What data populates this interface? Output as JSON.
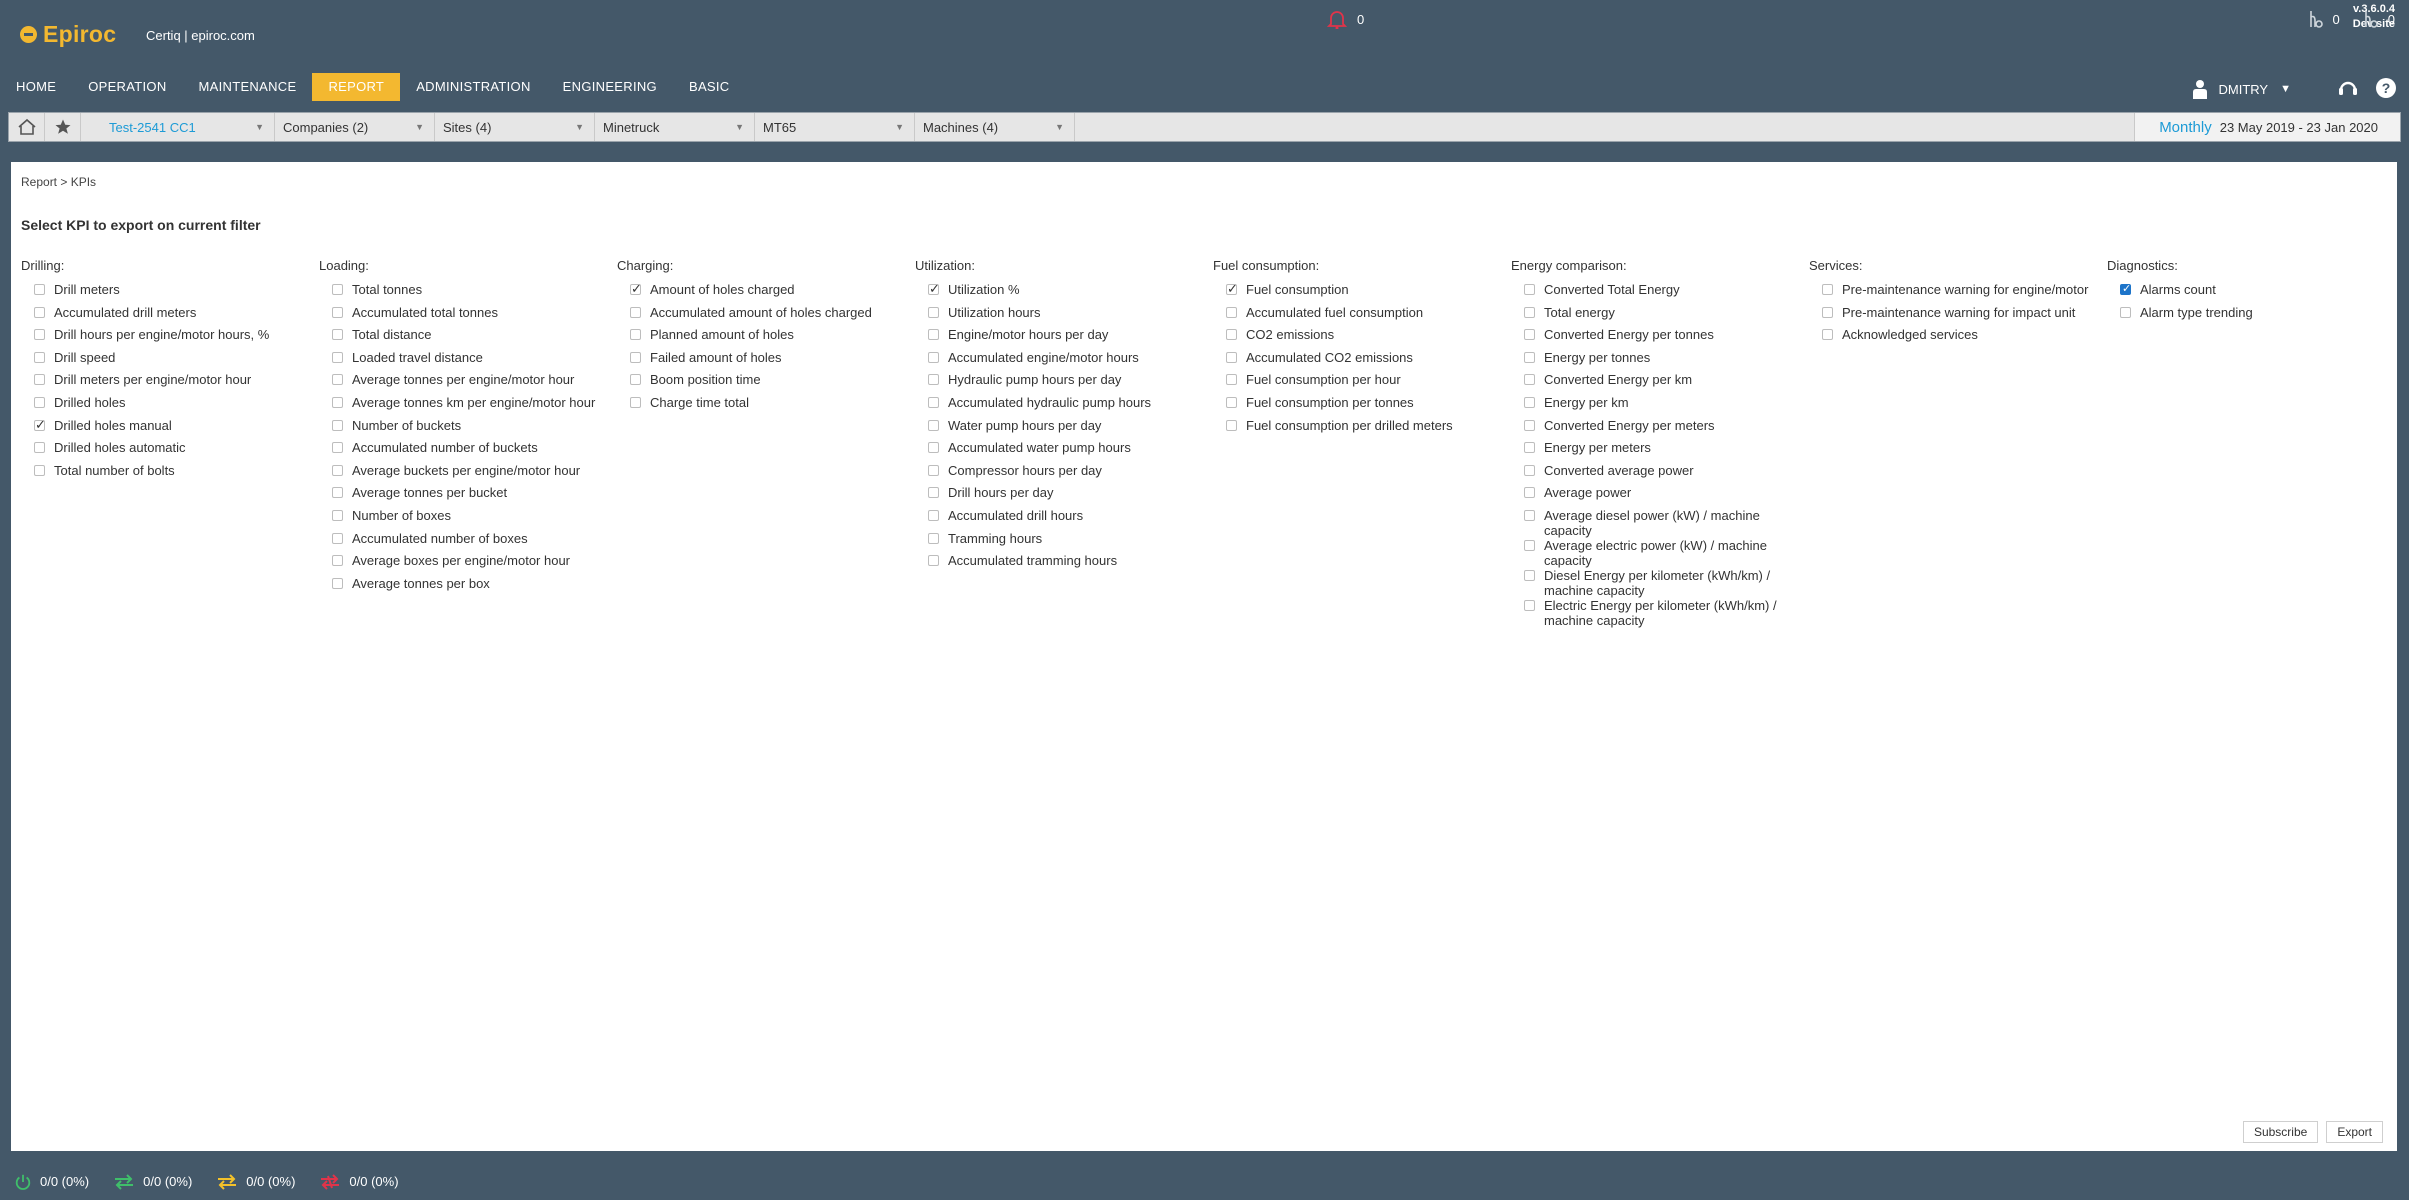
{
  "header": {
    "logo_text": "Epiroc",
    "site_name": "Certiq | epiroc.com",
    "version_line1": "v.3.6.0.4",
    "version_line2": "Dev site"
  },
  "nav": {
    "items": [
      "HOME",
      "OPERATION",
      "MAINTENANCE",
      "REPORT",
      "ADMINISTRATION",
      "ENGINEERING",
      "BASIC"
    ],
    "active": "REPORT",
    "user_name": "DMITRY",
    "user_caret": "▼"
  },
  "filters": {
    "selects": [
      "Test-2541 CC1",
      "Companies (2)",
      "Sites (4)",
      "Minetruck",
      "MT65",
      "Machines (4)"
    ],
    "period_mode": "Monthly",
    "date_range": "23 May 2019 - 23 Jan 2020"
  },
  "page": {
    "breadcrumb": "Report > KPIs",
    "heading": "Select KPI to export on current filter"
  },
  "categories": [
    {
      "title": "Drilling:",
      "items": [
        {
          "label": "Drill meters",
          "checked": false
        },
        {
          "label": "Accumulated drill meters",
          "checked": false
        },
        {
          "label": "Drill hours per engine/motor hours, %",
          "checked": false
        },
        {
          "label": "Drill speed",
          "checked": false
        },
        {
          "label": "Drill meters per engine/motor hour",
          "checked": false
        },
        {
          "label": "Drilled holes",
          "checked": false
        },
        {
          "label": "Drilled holes manual",
          "checked": true
        },
        {
          "label": "Drilled holes automatic",
          "checked": false
        },
        {
          "label": "Total number of bolts",
          "checked": false
        }
      ]
    },
    {
      "title": "Loading:",
      "items": [
        {
          "label": "Total tonnes",
          "checked": false
        },
        {
          "label": "Accumulated total tonnes",
          "checked": false
        },
        {
          "label": "Total distance",
          "checked": false
        },
        {
          "label": "Loaded travel distance",
          "checked": false
        },
        {
          "label": "Average tonnes per engine/motor hour",
          "checked": false
        },
        {
          "label": "Average tonnes km per engine/motor hour",
          "checked": false
        },
        {
          "label": "Number of buckets",
          "checked": false
        },
        {
          "label": "Accumulated number of buckets",
          "checked": false
        },
        {
          "label": "Average buckets per engine/motor hour",
          "checked": false
        },
        {
          "label": "Average tonnes per bucket",
          "checked": false
        },
        {
          "label": "Number of boxes",
          "checked": false
        },
        {
          "label": "Accumulated number of boxes",
          "checked": false
        },
        {
          "label": "Average boxes per engine/motor hour",
          "checked": false
        },
        {
          "label": "Average tonnes per box",
          "checked": false
        }
      ]
    },
    {
      "title": "Charging:",
      "items": [
        {
          "label": "Amount of holes charged",
          "checked": true
        },
        {
          "label": "Accumulated amount of holes charged",
          "checked": false
        },
        {
          "label": "Planned amount of holes",
          "checked": false
        },
        {
          "label": "Failed amount of holes",
          "checked": false
        },
        {
          "label": "Boom position time",
          "checked": false
        },
        {
          "label": "Charge time total",
          "checked": false
        }
      ]
    },
    {
      "title": "Utilization:",
      "items": [
        {
          "label": "Utilization %",
          "checked": true
        },
        {
          "label": "Utilization hours",
          "checked": false
        },
        {
          "label": "Engine/motor hours per day",
          "checked": false
        },
        {
          "label": "Accumulated engine/motor hours",
          "checked": false
        },
        {
          "label": "Hydraulic pump hours per day",
          "checked": false
        },
        {
          "label": "Accumulated hydraulic pump hours",
          "checked": false
        },
        {
          "label": "Water pump hours per day",
          "checked": false
        },
        {
          "label": "Accumulated water pump hours",
          "checked": false
        },
        {
          "label": "Compressor hours per day",
          "checked": false
        },
        {
          "label": "Drill hours per day",
          "checked": false
        },
        {
          "label": "Accumulated drill hours",
          "checked": false
        },
        {
          "label": "Tramming hours",
          "checked": false
        },
        {
          "label": "Accumulated tramming hours",
          "checked": false
        }
      ]
    },
    {
      "title": "Fuel consumption:",
      "items": [
        {
          "label": "Fuel consumption",
          "checked": true
        },
        {
          "label": "Accumulated fuel consumption",
          "checked": false
        },
        {
          "label": "CO2 emissions",
          "checked": false
        },
        {
          "label": "Accumulated CO2 emissions",
          "checked": false
        },
        {
          "label": "Fuel consumption per hour",
          "checked": false
        },
        {
          "label": "Fuel consumption per tonnes",
          "checked": false
        },
        {
          "label": "Fuel consumption per drilled meters",
          "checked": false
        }
      ]
    },
    {
      "title": "Energy comparison:",
      "items": [
        {
          "label": "Converted Total Energy",
          "checked": false
        },
        {
          "label": "Total energy",
          "checked": false
        },
        {
          "label": "Converted Energy per tonnes",
          "checked": false
        },
        {
          "label": "Energy per tonnes",
          "checked": false
        },
        {
          "label": "Converted Energy per km",
          "checked": false
        },
        {
          "label": "Energy per km",
          "checked": false
        },
        {
          "label": "Converted Energy per meters",
          "checked": false
        },
        {
          "label": "Energy per meters",
          "checked": false
        },
        {
          "label": "Converted average power",
          "checked": false
        },
        {
          "label": "Average power",
          "checked": false
        },
        {
          "label": "Average diesel power (kW) / machine capacity",
          "checked": false
        },
        {
          "label": "Average electric power (kW) / machine capacity",
          "checked": false
        },
        {
          "label": "Diesel Energy per kilometer (kWh/km) / machine capacity",
          "checked": false
        },
        {
          "label": "Electric Energy per kilometer (kWh/km) / machine capacity",
          "checked": false
        }
      ]
    },
    {
      "title": "Services:",
      "items": [
        {
          "label": "Pre-maintenance warning for engine/motor",
          "checked": false
        },
        {
          "label": "Pre-maintenance warning for impact unit",
          "checked": false
        },
        {
          "label": "Acknowledged services",
          "checked": false
        }
      ]
    },
    {
      "title": "Diagnostics:",
      "items": [
        {
          "label": "Alarms count",
          "checked": true,
          "style": "blue"
        },
        {
          "label": "Alarm type trending",
          "checked": false
        }
      ]
    }
  ],
  "actions": {
    "subscribe": "Subscribe",
    "export": "Export"
  },
  "statusbar": {
    "stats": [
      {
        "icon": "power-icon",
        "color": "#3fbf6a",
        "value": "0/0 (0%)"
      },
      {
        "icon": "swap-green-icon",
        "color": "#3fbf6a",
        "value": "0/0 (0%)"
      },
      {
        "icon": "swap-yellow-icon",
        "color": "#f3c12a",
        "value": "0/0 (0%)"
      },
      {
        "icon": "swap-broken-icon",
        "color": "#e0344a",
        "value": "0/0 (0%)"
      }
    ],
    "alarm_count": "0",
    "right_counts": [
      "0",
      "0"
    ]
  },
  "colors": {
    "background": "#445869",
    "accent": "#f3b830",
    "link": "#1d9bd6"
  }
}
